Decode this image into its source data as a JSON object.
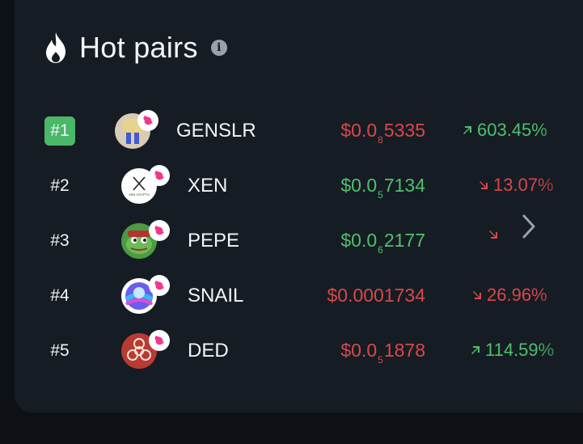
{
  "header": {
    "title": "Hot pairs",
    "info_icon": "info-icon",
    "flame_icon": "flame-icon"
  },
  "colors": {
    "up": "#4fc06d",
    "down": "#d7494a",
    "rank_active_bg": "#49b869",
    "card_bg": "#161c24"
  },
  "pairs": [
    {
      "rank": "#1",
      "symbol": "GENSLR",
      "price_prefix": "$0.0",
      "price_zeros": "8",
      "price_digits": "5335",
      "price_color": "red",
      "change": "603.45%",
      "direction": "up",
      "active": true,
      "avatar_icon": "genslr-avatar"
    },
    {
      "rank": "#2",
      "symbol": "XEN",
      "price_prefix": "$0.0",
      "price_zeros": "5",
      "price_digits": "7134",
      "price_color": "green",
      "change": "13.07%",
      "direction": "down",
      "active": false,
      "avatar_icon": "xen-avatar"
    },
    {
      "rank": "#3",
      "symbol": "PEPE",
      "price_prefix": "$0.0",
      "price_zeros": "6",
      "price_digits": "2177",
      "price_color": "green",
      "change": "",
      "direction": "down",
      "active": false,
      "avatar_icon": "pepe-avatar"
    },
    {
      "rank": "#4",
      "symbol": "SNAIL",
      "price_prefix": "$0.0001734",
      "price_zeros": "",
      "price_digits": "",
      "price_color": "red",
      "change": "26.96%",
      "direction": "down",
      "active": false,
      "avatar_icon": "snail-avatar"
    },
    {
      "rank": "#5",
      "symbol": "DED",
      "price_prefix": "$0.0",
      "price_zeros": "5",
      "price_digits": "1878",
      "price_color": "red",
      "change": "114.59%",
      "direction": "up",
      "active": false,
      "avatar_icon": "ded-avatar"
    }
  ],
  "xen_logo_text": "XEN CRYPTO"
}
